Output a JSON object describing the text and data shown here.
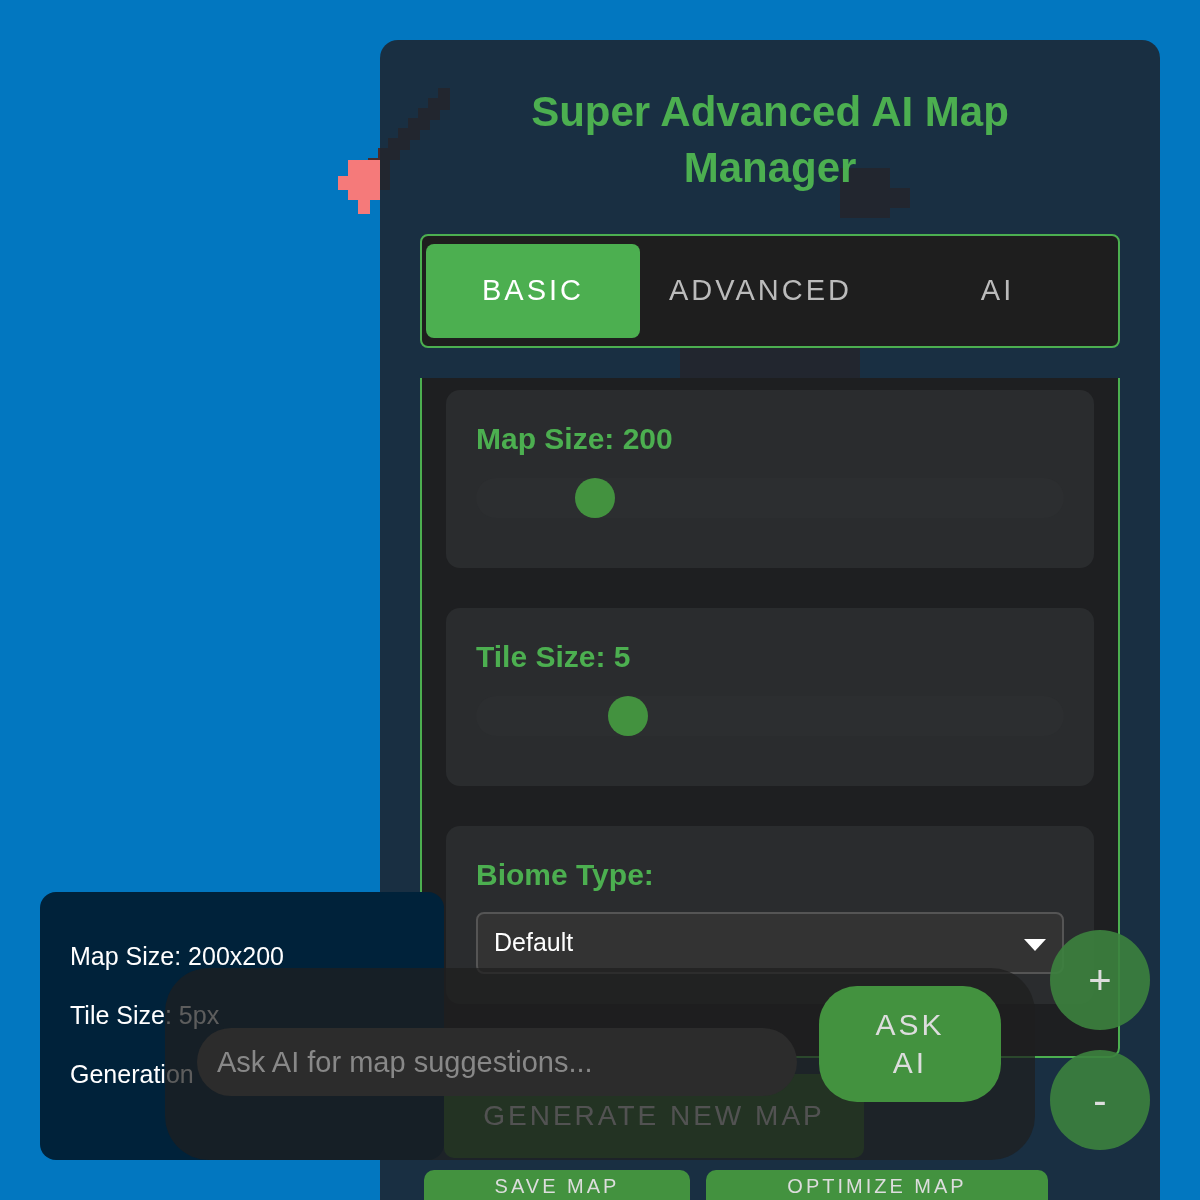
{
  "title": "Super Advanced AI Map Manager",
  "tabs": [
    {
      "label": "BASIC",
      "selected": true
    },
    {
      "label": "ADVANCED",
      "selected": false
    },
    {
      "label": "AI",
      "selected": false
    }
  ],
  "settings": [
    {
      "kind": "slider",
      "label": "Map Size: 200",
      "level": 0.18
    },
    {
      "kind": "slider",
      "label": "Tile Size: 5",
      "level": 0.24
    },
    {
      "kind": "select",
      "label": "Biome Type:",
      "value": "Default"
    }
  ],
  "generate_button": "GENERATE NEW MAP",
  "action_buttons": [
    "SAVE MAP",
    "OPTIMIZE MAP"
  ],
  "info": [
    "Map Size: 200x200",
    "Tile Size: 5px",
    "Generation"
  ],
  "ai_prompt": {
    "placeholder": "Ask AI for map suggestions...",
    "button": "ASK AI"
  },
  "zoom_buttons": [
    "+",
    "-"
  ]
}
